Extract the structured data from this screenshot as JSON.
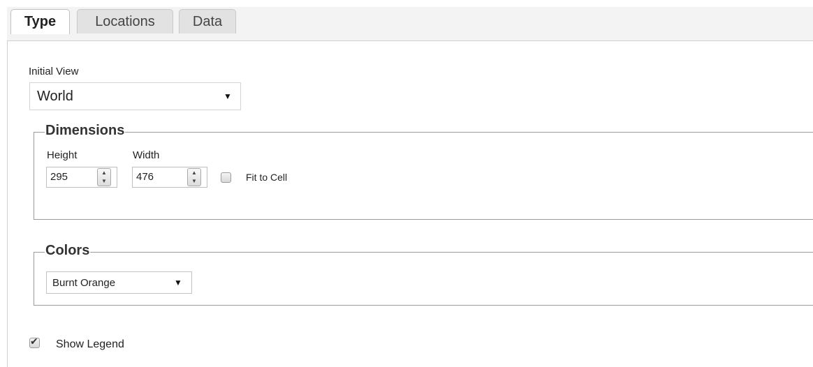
{
  "tabs": [
    {
      "label": "Type",
      "active": true
    },
    {
      "label": "Locations",
      "active": false
    },
    {
      "label": "Data",
      "active": false
    }
  ],
  "initial_view": {
    "label": "Initial View",
    "selected": "World",
    "arrow_icon": "triangle-down-icon"
  },
  "dimensions": {
    "legend": "Dimensions",
    "height_label": "Height",
    "height_value": "295",
    "width_label": "Width",
    "width_value": "476",
    "fit_to_cell_label": "Fit to Cell",
    "fit_to_cell_checked": false
  },
  "colors": {
    "legend": "Colors",
    "selected": "Burnt Orange"
  },
  "show_legend": {
    "label": "Show Legend",
    "checked": true
  }
}
